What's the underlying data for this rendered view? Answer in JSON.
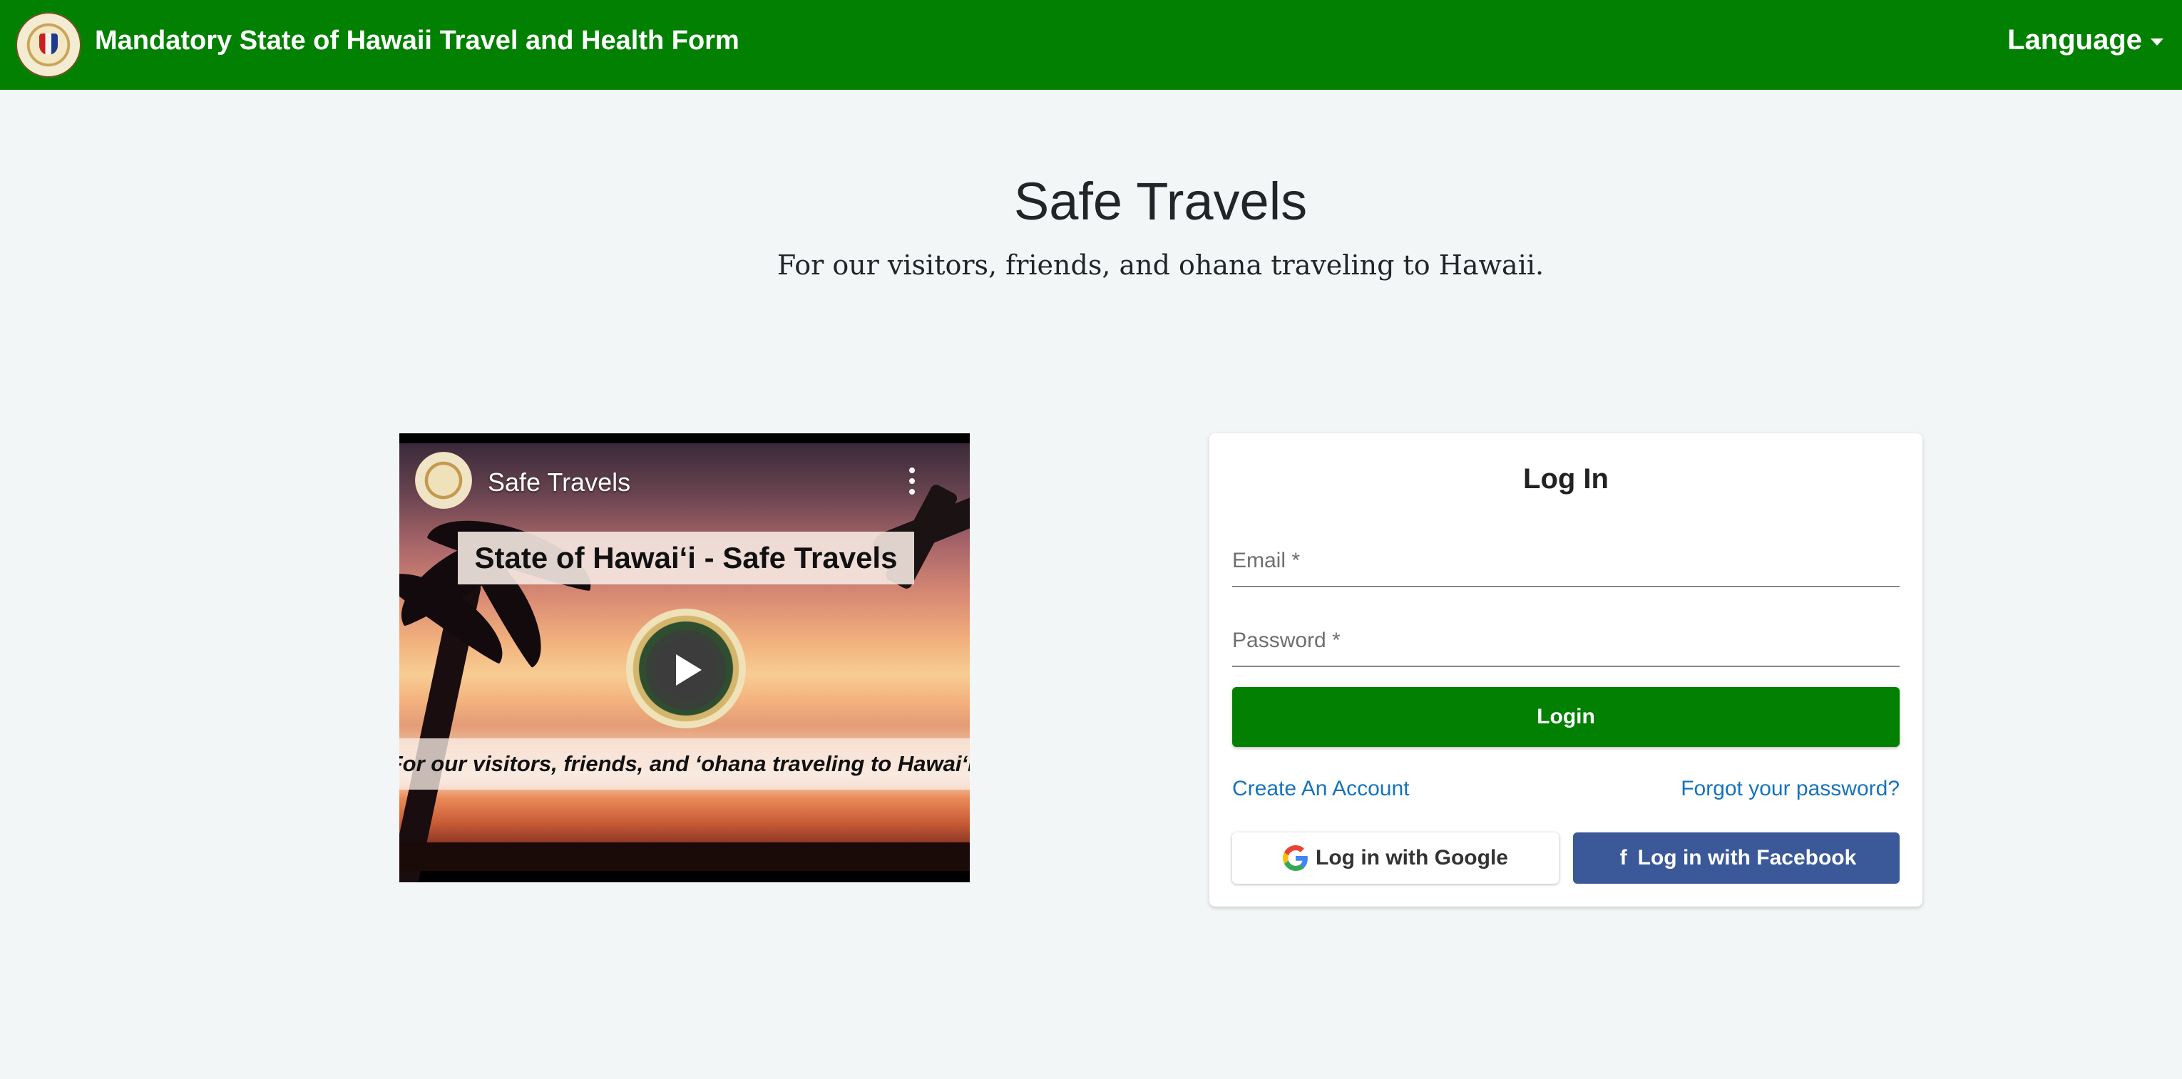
{
  "header": {
    "app_title": "Mandatory State of Hawaii Travel and Health Form",
    "language_label": "Language",
    "brand_color": "#018001",
    "seal_icon": "state-seal-icon"
  },
  "hero": {
    "title": "Safe Travels",
    "subtitle": "For our visitors, friends, and ohana traveling to Hawaii."
  },
  "video": {
    "channel_name": "Safe Travels",
    "title_overlay": "State of Hawaiʻi - Safe Travels",
    "tagline_overlay": "For our visitors, friends, and ʻohana traveling to Hawaiʻi.",
    "play_icon": "play-icon",
    "menu_icon": "more-vert-icon"
  },
  "login": {
    "title": "Log In",
    "email_placeholder": "Email *",
    "email_value": "",
    "password_placeholder": "Password *",
    "password_value": "",
    "login_button": "Login",
    "create_account_link": "Create An Account",
    "forgot_password_link": "Forgot your password?",
    "google_button": "Log in with Google",
    "facebook_button": "Log in with Facebook",
    "link_color": "#1673bd",
    "facebook_color": "#3b5998"
  }
}
